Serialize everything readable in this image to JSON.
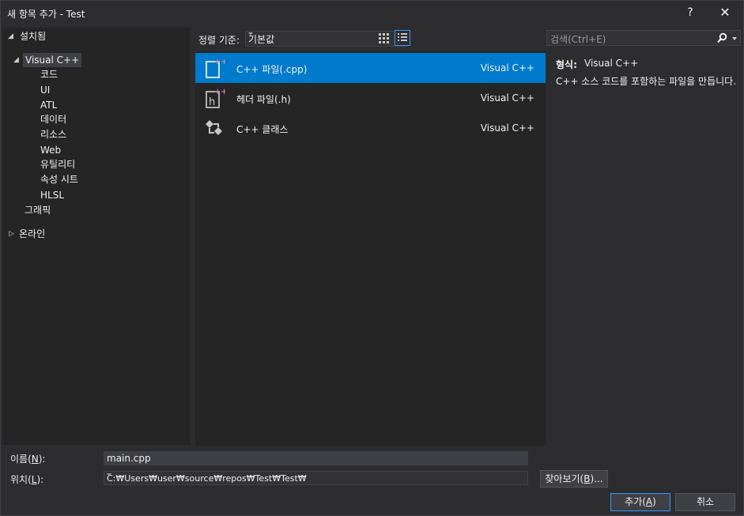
{
  "window": {
    "title": "새 항목 추가 - Test",
    "help_label": "?",
    "close_label": "✕"
  },
  "tree": {
    "installed_label": "설치됨",
    "visual_cpp_label": "Visual C++",
    "children": [
      "코드",
      "UI",
      "ATL",
      "데이터",
      "리소스",
      "Web",
      "유틸리티",
      "속성 시트",
      "HLSL"
    ],
    "graphics_label": "그래픽",
    "online_label": "온라인"
  },
  "toolbar": {
    "sort_label": "정렬 기준:",
    "sort_value": "기본값"
  },
  "templates": [
    {
      "name": "C++ 파일(.cpp)",
      "lang": "Visual C++",
      "icon": "cpp-file-icon"
    },
    {
      "name": "헤더 파일(.h)",
      "lang": "Visual C++",
      "icon": "header-file-icon"
    },
    {
      "name": "C++ 클래스",
      "lang": "Visual C++",
      "icon": "cpp-class-icon"
    }
  ],
  "search": {
    "placeholder": "검색(Ctrl+E)"
  },
  "details": {
    "type_label": "형식:",
    "type_value": "Visual C++",
    "description": "C++ 소스 코드를 포함하는 파일을 만듭니다."
  },
  "form": {
    "name_label_pre": "이름(",
    "name_label_key": "N",
    "name_label_post": "):",
    "name_value": "main.cpp",
    "location_label_pre": "위치(",
    "location_label_key": "L",
    "location_label_post": "):",
    "location_value": "C:₩Users₩user₩source₩repos₩Test₩Test₩",
    "browse_pre": "찾아보기(",
    "browse_key": "B",
    "browse_post": ")...",
    "add_pre": "추가(",
    "add_key": "A",
    "add_post": ")",
    "cancel_label": "취소"
  },
  "colors": {
    "accent": "#007acc",
    "background": "#2d2d30",
    "panel": "#252526",
    "icon_purple": "#c586c0"
  }
}
